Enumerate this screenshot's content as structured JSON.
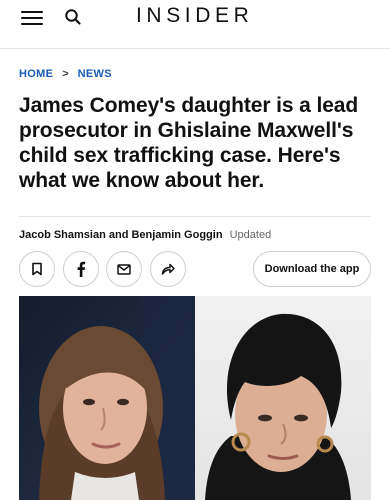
{
  "header": {
    "logo_text": "INSIDER",
    "menu_icon": "hamburger-menu-icon",
    "search_icon": "search-icon"
  },
  "breadcrumb": {
    "home": "HOME",
    "separator": ">",
    "section": "NEWS"
  },
  "article": {
    "headline": "James Comey's daughter is a lead prosecutor in Ghislaine Maxwell's child sex trafficking case. Here's what we know about her.",
    "authors": "Jacob Shamsian and Benjamin Goggin",
    "updated_label": "Updated"
  },
  "share": {
    "icons": [
      "bookmark-icon",
      "facebook-icon",
      "email-icon",
      "share-arrow-icon"
    ],
    "download_app_label": "Download the app"
  },
  "colors": {
    "link_blue": "#1a5bb4",
    "text": "#111111",
    "border": "#cfcfcf"
  }
}
